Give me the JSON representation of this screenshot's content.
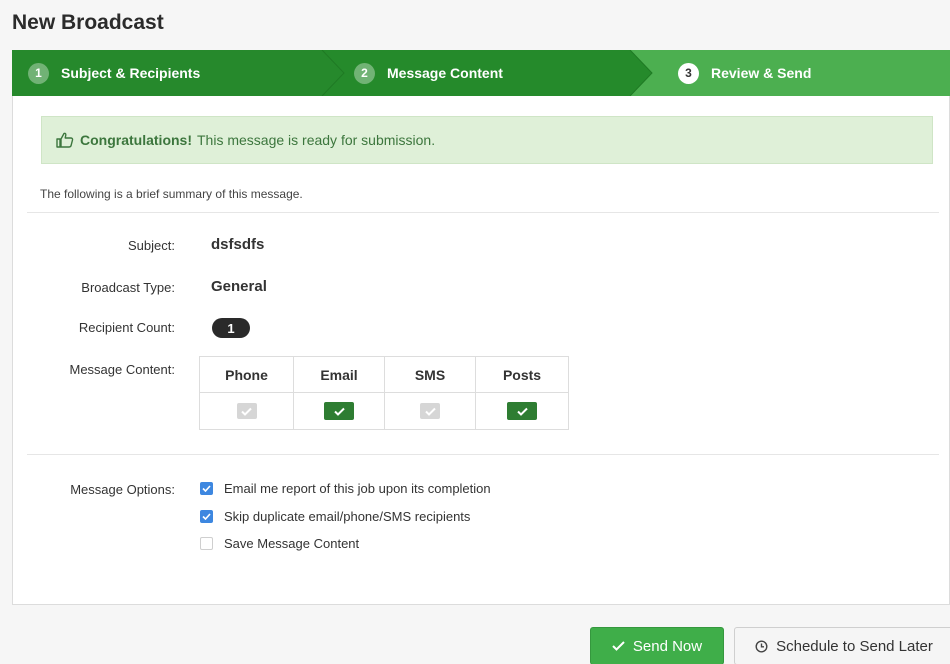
{
  "page": {
    "title": "New Broadcast"
  },
  "wizard": {
    "steps": [
      {
        "number": "1",
        "label": "Subject & Recipients",
        "state": "complete"
      },
      {
        "number": "2",
        "label": "Message Content",
        "state": "complete"
      },
      {
        "number": "3",
        "label": "Review & Send",
        "state": "active"
      }
    ]
  },
  "alert": {
    "icon": "thumbs-up-icon",
    "strong": "Congratulations!",
    "text": "This message is ready for submission."
  },
  "summary": {
    "intro": "The following is a brief summary of this message."
  },
  "fields": {
    "subject_label": "Subject:",
    "subject_value": "dsfsdfs",
    "type_label": "Broadcast Type:",
    "type_value": "General",
    "count_label": "Recipient Count:",
    "count_value": "1",
    "content_label": "Message Content:"
  },
  "message_content": {
    "columns": [
      {
        "name": "Phone",
        "checked": false
      },
      {
        "name": "Email",
        "checked": true
      },
      {
        "name": "SMS",
        "checked": false
      },
      {
        "name": "Posts",
        "checked": true
      }
    ]
  },
  "options": {
    "label": "Message Options:",
    "items": [
      {
        "label": "Email me report of this job upon its completion",
        "checked": true
      },
      {
        "label": "Skip duplicate email/phone/SMS recipients",
        "checked": true
      },
      {
        "label": "Save Message Content",
        "checked": false
      }
    ]
  },
  "actions": {
    "send_now": "Send Now",
    "schedule": "Schedule to Send Later"
  },
  "colors": {
    "wizard_complete": "#2e8b2e",
    "wizard_active": "#4caf50",
    "alert_bg": "#dff0d8",
    "send_button": "#3fae49",
    "checkbox_checked": "#3d87e0"
  }
}
